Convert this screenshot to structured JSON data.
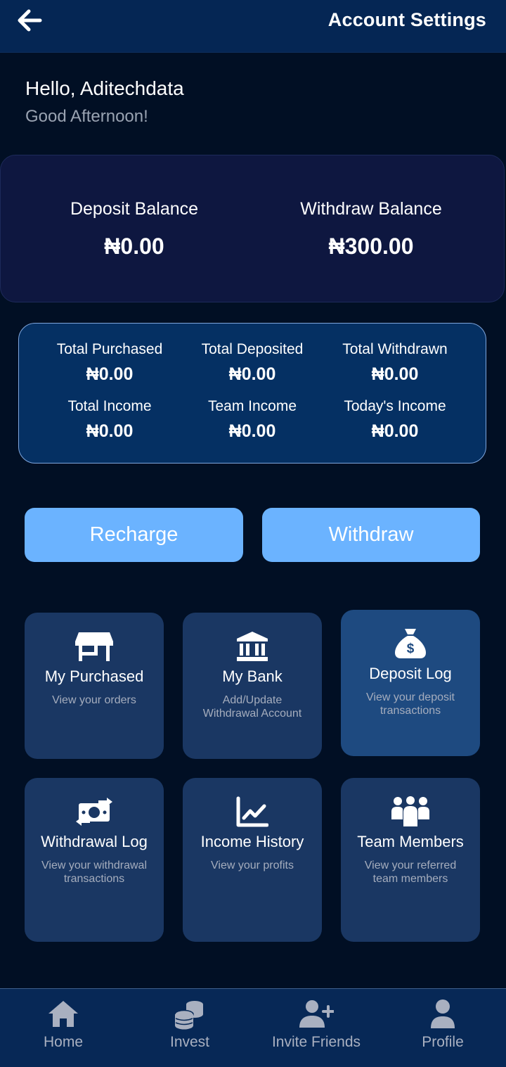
{
  "header": {
    "title": "Account Settings"
  },
  "greeting": {
    "hello": "Hello, Aditechdata",
    "sub": "Good Afternoon!"
  },
  "balances": {
    "deposit_label": "Deposit Balance",
    "deposit_value": "₦0.00",
    "withdraw_label": "Withdraw Balance",
    "withdraw_value": "₦300.00"
  },
  "stats": [
    {
      "label": "Total Purchased",
      "value": "₦0.00"
    },
    {
      "label": "Total Deposited",
      "value": "₦0.00"
    },
    {
      "label": "Total Withdrawn",
      "value": "₦0.00"
    },
    {
      "label": "Total Income",
      "value": "₦0.00"
    },
    {
      "label": "Team Income",
      "value": "₦0.00"
    },
    {
      "label": "Today's Income",
      "value": "₦0.00"
    }
  ],
  "actions": {
    "recharge": "Recharge",
    "withdraw": "Withdraw"
  },
  "tiles": [
    {
      "icon": "store-icon",
      "title": "My Purchased",
      "desc": "View your orders"
    },
    {
      "icon": "bank-icon",
      "title": "My Bank",
      "desc": "Add/Update Withdrawal Account"
    },
    {
      "icon": "money-bag-icon",
      "title": "Deposit Log",
      "desc": "View your deposit transactions"
    },
    {
      "icon": "money-exchange-icon",
      "title": "Withdrawal Log",
      "desc": "View your withdrawal transactions"
    },
    {
      "icon": "chart-line-icon",
      "title": "Income History",
      "desc": "View your profits"
    },
    {
      "icon": "people-group-icon",
      "title": "Team Members",
      "desc": "View your referred team members"
    }
  ],
  "nav": [
    {
      "icon": "home-icon",
      "label": "Home"
    },
    {
      "icon": "coins-icon",
      "label": "Invest"
    },
    {
      "icon": "user-plus-icon",
      "label": "Invite Friends"
    },
    {
      "icon": "user-icon",
      "label": "Profile"
    }
  ],
  "colors": {
    "background": "#010f24",
    "header": "#052654",
    "accent_button": "#6bb3ff",
    "tile": "#1a3763",
    "tile_alt": "#1e4a80"
  }
}
